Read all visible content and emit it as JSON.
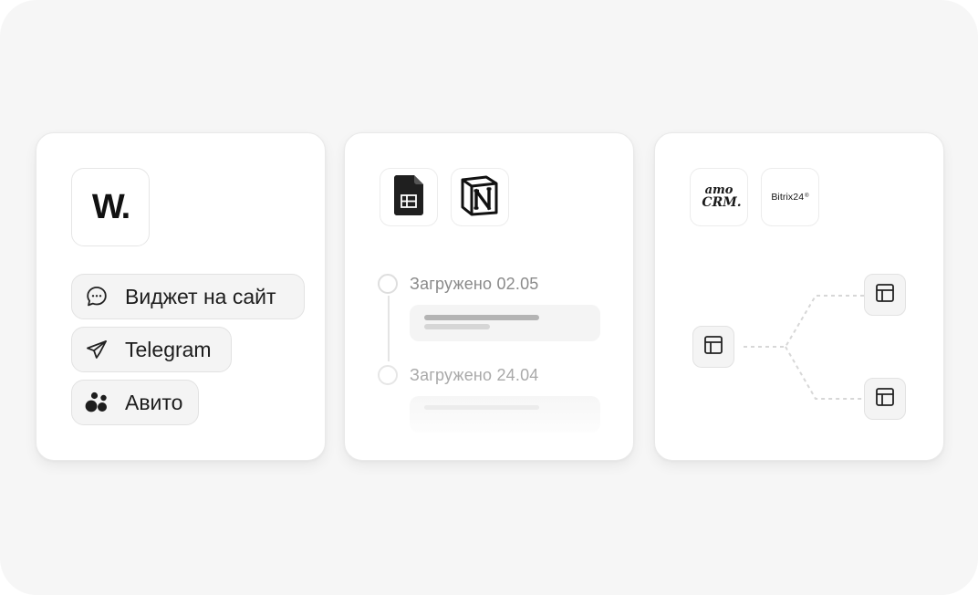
{
  "channels_card": {
    "logo_text": "W.",
    "chips": [
      {
        "label": "Виджет на сайт",
        "icon": "chat-bubble-icon"
      },
      {
        "label": "Telegram",
        "icon": "paper-plane-icon"
      },
      {
        "label": "Авито",
        "icon": "avito-dots-icon"
      }
    ]
  },
  "knowledge_card": {
    "apps": [
      {
        "name": "google-sheets-icon"
      },
      {
        "name": "notion-icon"
      }
    ],
    "timeline": [
      {
        "label": "Загружено 02.05"
      },
      {
        "label": "Загружено 24.04"
      }
    ]
  },
  "crm_card": {
    "amocrm_top": "amo",
    "amocrm_bottom": "CRM.",
    "bitrix_label": "Bitrix24",
    "bitrix_mark": "®",
    "nodes_icon": "table-icon"
  }
}
